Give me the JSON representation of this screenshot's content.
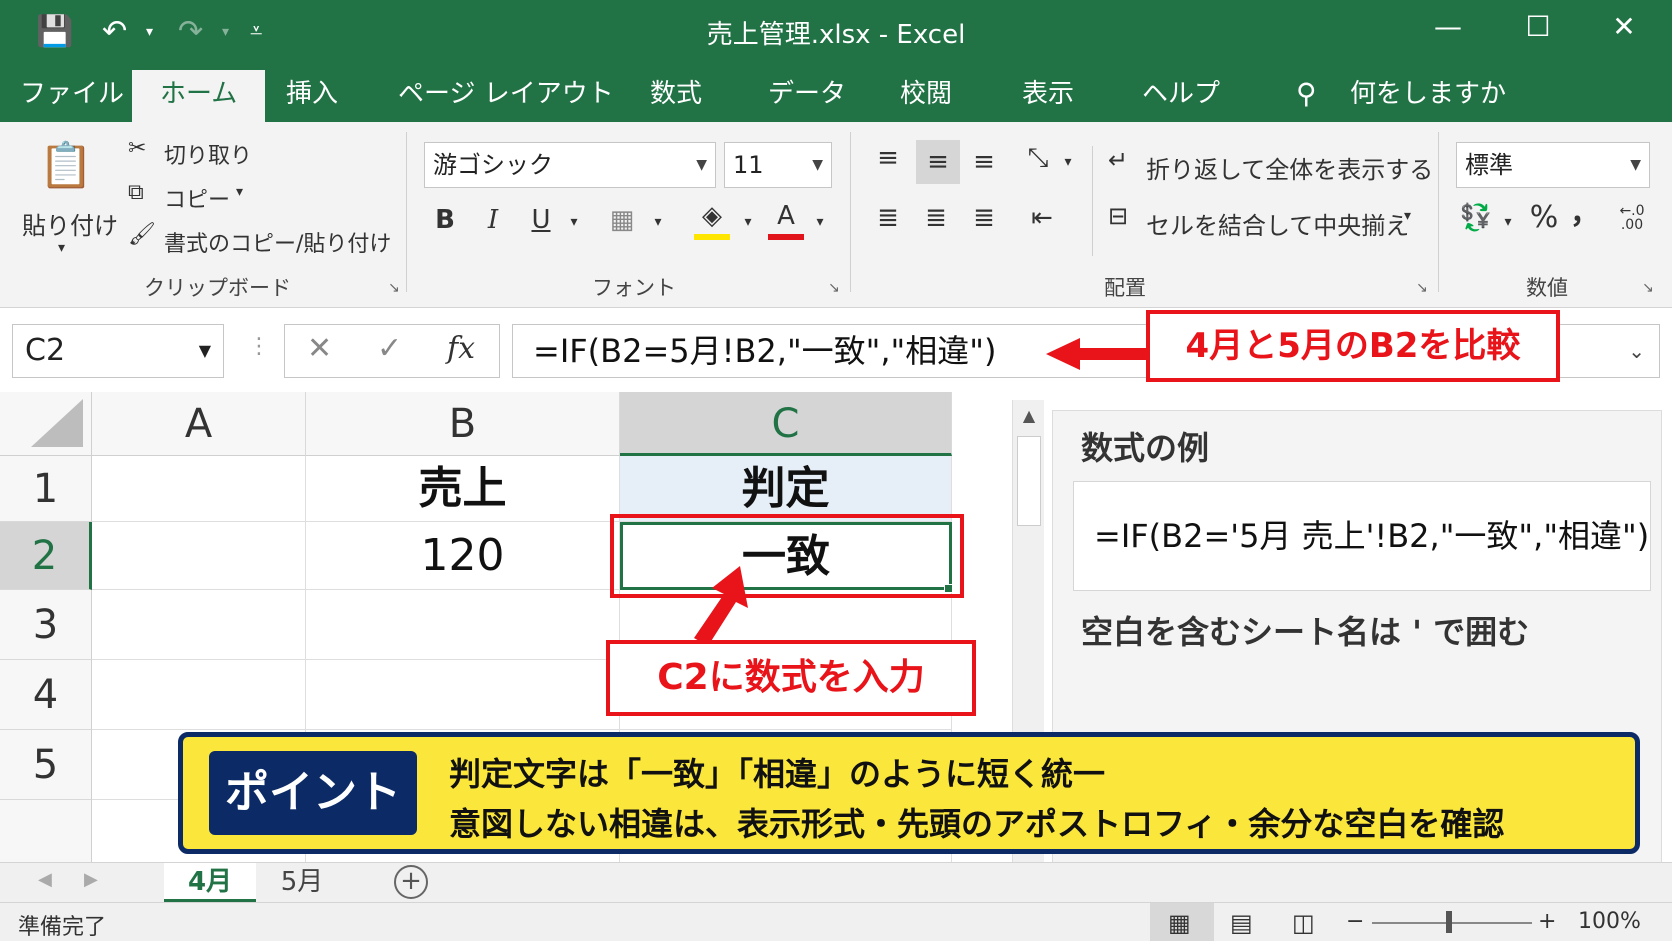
{
  "window": {
    "title": "売上管理.xlsx  -  Excel",
    "minimize_icon": "—",
    "maximize_icon": "☐",
    "close_icon": "✕"
  },
  "quick_access": {
    "save_icon": "💾",
    "undo_icon": "↶",
    "redo_icon": "↷",
    "customize_icon": "⩡"
  },
  "tabs": [
    "ファイル",
    "ホーム",
    "挿入",
    "ページ レイアウト",
    "数式",
    "データ",
    "校閲",
    "表示",
    "ヘルプ"
  ],
  "active_tab": "ホーム",
  "tell_me": "何をしますか",
  "ribbon": {
    "clipboard": {
      "paste": "貼り付け",
      "cut": "切り取り",
      "copy": "コピー",
      "format_painter": "書式のコピー/貼り付け",
      "group_label": "クリップボード"
    },
    "font": {
      "font_name": "游ゴシック",
      "font_size": "11",
      "bold": "B",
      "italic": "I",
      "underline": "U",
      "font_color": "A",
      "group_label": "フォント"
    },
    "alignment": {
      "wrap_text": "折り返して全体を表示する",
      "merge_center": "セルを結合して中央揃え",
      "group_label": "配置"
    },
    "number": {
      "format": "標準",
      "percent": "%",
      "comma": "，",
      "group_label": "数値"
    }
  },
  "formula_bar": {
    "name_box": "C2",
    "cancel": "✕",
    "enter": "✓",
    "fx": "fx",
    "formula": "=IF(B2=5月!B2,\"一致\",\"相違\")"
  },
  "sheet": {
    "columns": [
      "A",
      "B",
      "C"
    ],
    "rows": [
      "1",
      "2",
      "3",
      "4",
      "5"
    ],
    "cells": {
      "B1": "売上",
      "C1": "判定",
      "B2": "120",
      "C2": "一致"
    },
    "active_cell": "C2"
  },
  "annotations": {
    "formula_callout": "4月と5月のB2を比較",
    "cell_callout": "C2に数式を入力",
    "accent_color": "#e8141a"
  },
  "side_panel": {
    "title": "数式の例",
    "example": "=IF(B2='5月 売上'!B2,\"一致\",\"相違\")",
    "note": "空白を含むシート名は ' で囲む"
  },
  "point": {
    "badge": "ポイント",
    "line1": "判定文字は「一致」「相違」のように短く統一",
    "line2": "意図しない相違は、表示形式・先頭のアポストロフィ・余分な空白を確認"
  },
  "sheet_tabs": [
    "4月",
    "5月"
  ],
  "active_sheet": "4月",
  "status": {
    "ready": "準備完了",
    "zoom": "100%"
  },
  "colors": {
    "excel_green": "#217346",
    "point_bg": "#fbe73b",
    "point_border": "#0c2b66"
  }
}
